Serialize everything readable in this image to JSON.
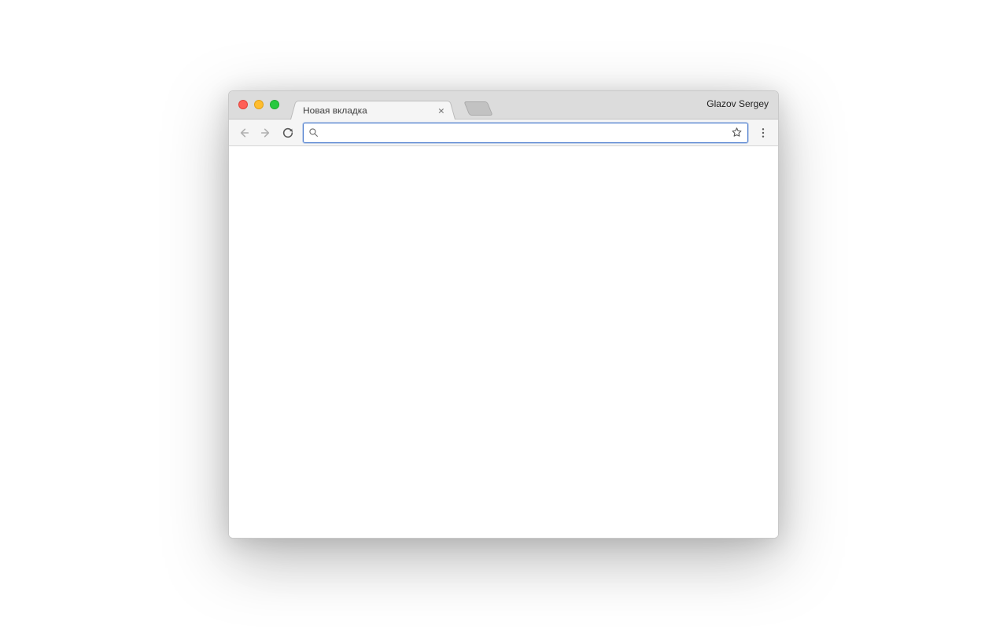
{
  "tabstrip": {
    "tabs": [
      {
        "title": "Новая вкладка"
      }
    ],
    "profile_name": "Glazov Sergey"
  },
  "toolbar": {
    "omnibox_value": "",
    "omnibox_placeholder": ""
  }
}
